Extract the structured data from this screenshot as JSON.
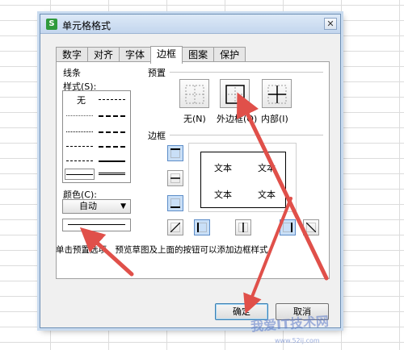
{
  "dialog": {
    "title": "单元格格式",
    "app_icon": "S",
    "close_glyph": "✕"
  },
  "tabs": [
    "数字",
    "对齐",
    "字体",
    "边框",
    "图案",
    "保护"
  ],
  "active_tab": "边框",
  "line_section": {
    "group_label": "线条",
    "style_label": "样式(S):",
    "none_label": "无",
    "color_label": "颜色(C):",
    "color_value": "自动"
  },
  "presets": {
    "group_label": "预置",
    "none_label": "无(N)",
    "outline_label": "外边框(O)",
    "inside_label": "内部(I)"
  },
  "border": {
    "group_label": "边框",
    "preview_text": [
      "文本",
      "文本",
      "文本",
      "文本"
    ]
  },
  "hint": "单击预置选项、预览草图及上面的按钮可以添加边框样式。",
  "buttons": {
    "ok": "确定",
    "cancel": "取消"
  },
  "watermark": {
    "text": "我爱IT技术网",
    "url": "www.52ij.com"
  },
  "colors": {
    "accent": "#2f9a3c",
    "annotation_arrow": "#e0504a",
    "selected_button": "#c9dff7"
  }
}
